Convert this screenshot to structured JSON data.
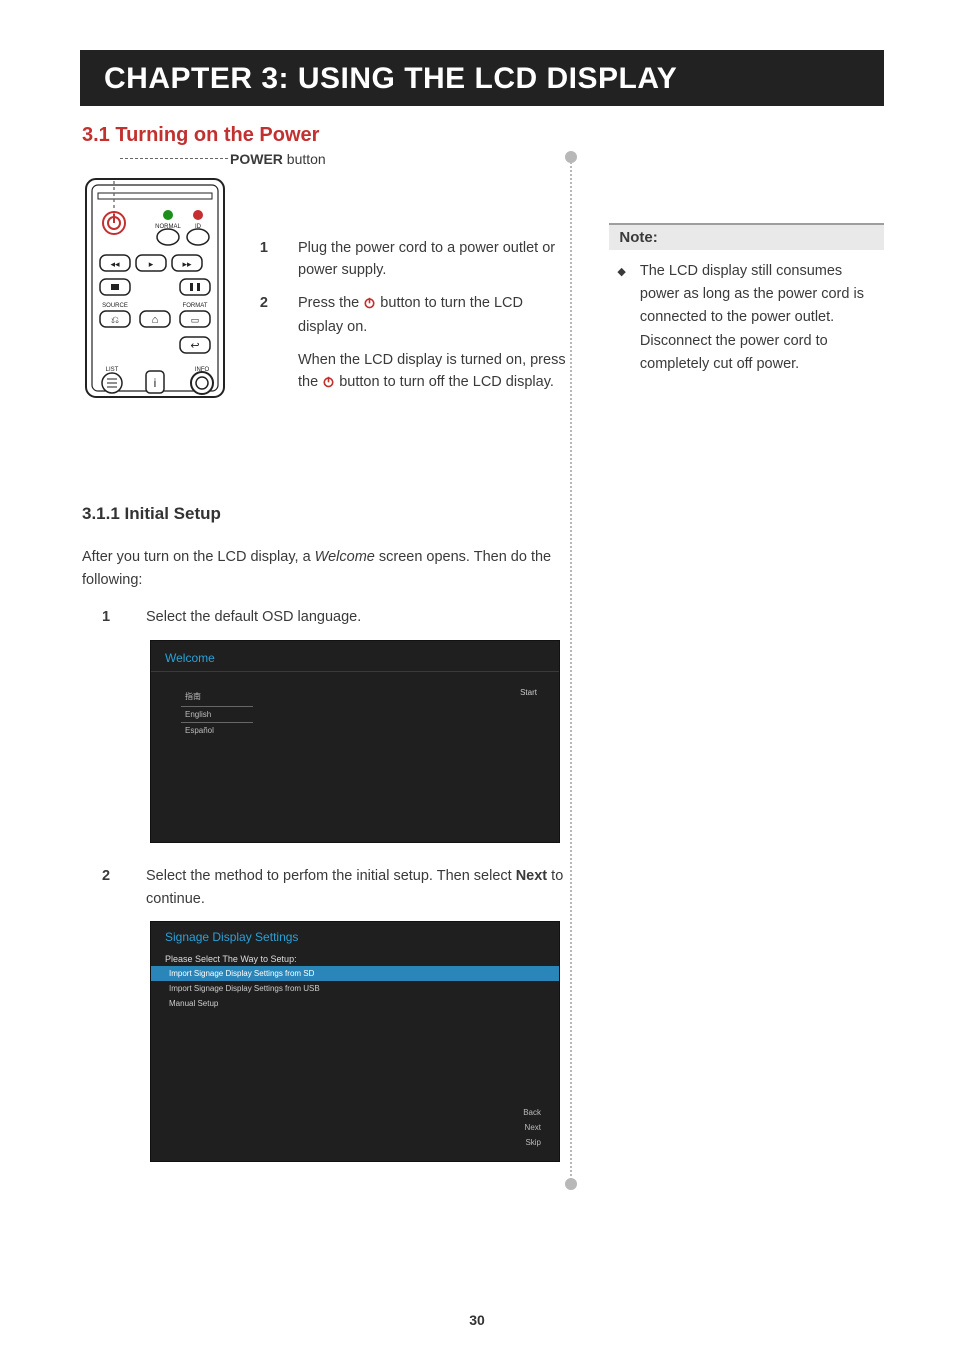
{
  "chapter_title": "CHAPTER 3: USING THE LCD DISPLAY",
  "section_3_1_title": "3.1 Turning on the Power",
  "power_label_bold": "POWER",
  "power_label_rest": " button",
  "steps_power": {
    "s1_num": "1",
    "s1_text": "Plug the power cord to a power outlet or power supply.",
    "s2_num": "2",
    "s2_text_a": "Press the ",
    "s2_text_b": " button to turn the LCD display on.",
    "s2_sub_a": "When the LCD display is turned on, press the ",
    "s2_sub_b": " button to turn off the LCD display."
  },
  "note": {
    "heading": "Note:",
    "bullet": "The LCD display still consumes power as long as the power cord is connected to the power outlet. Disconnect the power cord to completely cut off power."
  },
  "section_3_1_1_title": "3.1.1   Initial Setup",
  "intro_a": "After you turn on the LCD display, a ",
  "intro_italic": "Welcome",
  "intro_b": " screen opens. Then do the following:",
  "step_lang": {
    "num": "1",
    "text": "Select the default OSD language."
  },
  "step_method": {
    "num": "2",
    "text_a": "Select the method to perfom the initial setup. Then select ",
    "bold": "Next",
    "text_b": " to continue."
  },
  "ui_welcome": {
    "title": "Welcome",
    "options": [
      "指南",
      "English",
      "Español"
    ],
    "start": "Start"
  },
  "ui_signage": {
    "title": "Signage Display Settings",
    "prompt": "Please Select The Way to Setup:",
    "rows": [
      "Import Signage Display Settings from SD",
      "Import Signage Display Settings from USB",
      "Manual Setup"
    ],
    "footer": [
      "Back",
      "Next",
      "Skip"
    ]
  },
  "remote_labels": {
    "normal": "NORMAL",
    "id": "ID",
    "source": "SOURCE",
    "format": "FORMAT",
    "list": "LIST",
    "info": "INFO"
  },
  "page_number": "30"
}
